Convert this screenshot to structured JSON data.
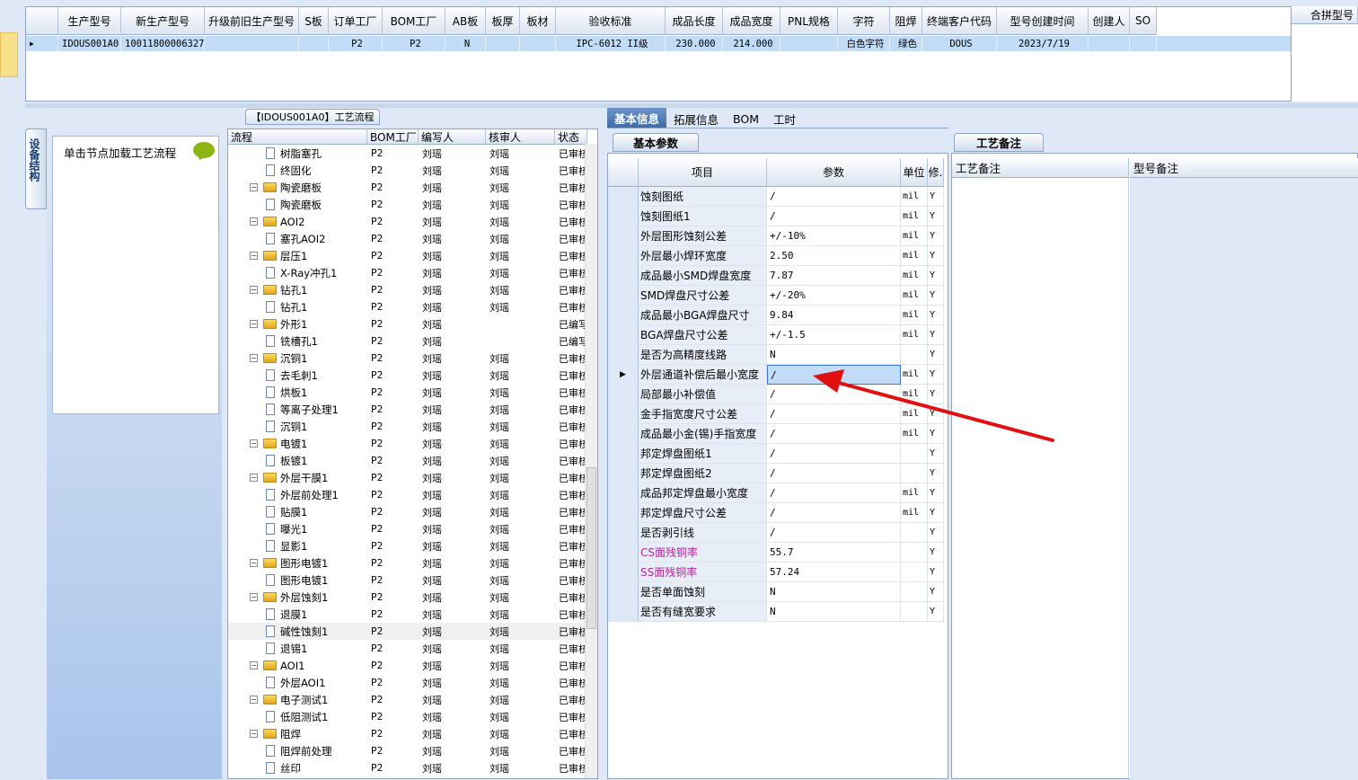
{
  "top_grid": {
    "headers": [
      "生产型号",
      "新生产型号",
      "升级前旧生产型号",
      "S板",
      "订单工厂",
      "BOM工厂",
      "AB板",
      "板厚",
      "板材",
      "验收标准",
      "成品长度",
      "成品宽度",
      "PNL规格",
      "字符",
      "阻焊",
      "终端客户代码",
      "型号创建时间",
      "创建人",
      "SO"
    ],
    "row": [
      "IDOUS001A0",
      "10011800006327",
      "",
      "",
      "P2",
      "P2",
      "N",
      "",
      "",
      "IPC-6012 II级",
      "230.000",
      "214.000",
      "",
      "白色字符",
      "绿色",
      "DOUS",
      "2023/7/19",
      "",
      ""
    ]
  },
  "right_panel": {
    "header": "合拼型号"
  },
  "tree_tab": "【IDOUS001A0】工艺流程",
  "side_tab": "设备结构",
  "load_text": "单击节点加载工艺流程",
  "tree": {
    "headers": [
      "流程",
      "BOM工厂",
      "编写人",
      "核审人",
      "状态"
    ],
    "rows": [
      {
        "level": 2,
        "type": "file",
        "name": "树脂塞孔",
        "bom": "P2",
        "writer": "刘瑶",
        "checker": "刘瑶",
        "status": "已审核"
      },
      {
        "level": 2,
        "type": "file",
        "name": "终固化",
        "bom": "P2",
        "writer": "刘瑶",
        "checker": "刘瑶",
        "status": "已审核"
      },
      {
        "level": 1,
        "type": "folder",
        "name": "陶瓷磨板",
        "bom": "P2",
        "writer": "刘瑶",
        "checker": "刘瑶",
        "status": "已审核"
      },
      {
        "level": 2,
        "type": "file",
        "name": "陶瓷磨板",
        "bom": "P2",
        "writer": "刘瑶",
        "checker": "刘瑶",
        "status": "已审核"
      },
      {
        "level": 1,
        "type": "folder",
        "name": "AOI2",
        "bom": "P2",
        "writer": "刘瑶",
        "checker": "刘瑶",
        "status": "已审核"
      },
      {
        "level": 2,
        "type": "file",
        "name": "塞孔AOI2",
        "bom": "P2",
        "writer": "刘瑶",
        "checker": "刘瑶",
        "status": "已审核"
      },
      {
        "level": 1,
        "type": "folder",
        "name": "层压1",
        "bom": "P2",
        "writer": "刘瑶",
        "checker": "刘瑶",
        "status": "已审核"
      },
      {
        "level": 2,
        "type": "file",
        "name": "X-Ray冲孔1",
        "bom": "P2",
        "writer": "刘瑶",
        "checker": "刘瑶",
        "status": "已审核"
      },
      {
        "level": 1,
        "type": "folder",
        "name": "钻孔1",
        "bom": "P2",
        "writer": "刘瑶",
        "checker": "刘瑶",
        "status": "已审核"
      },
      {
        "level": 2,
        "type": "file",
        "name": "钻孔1",
        "bom": "P2",
        "writer": "刘瑶",
        "checker": "刘瑶",
        "status": "已审核"
      },
      {
        "level": 1,
        "type": "folder",
        "name": "外形1",
        "bom": "P2",
        "writer": "刘瑶",
        "checker": "",
        "status": "已编写"
      },
      {
        "level": 2,
        "type": "file",
        "name": "铣槽孔1",
        "bom": "P2",
        "writer": "刘瑶",
        "checker": "",
        "status": "已编写"
      },
      {
        "level": 1,
        "type": "folder",
        "name": "沉铜1",
        "bom": "P2",
        "writer": "刘瑶",
        "checker": "刘瑶",
        "status": "已审核"
      },
      {
        "level": 2,
        "type": "file",
        "name": "去毛刺1",
        "bom": "P2",
        "writer": "刘瑶",
        "checker": "刘瑶",
        "status": "已审核"
      },
      {
        "level": 2,
        "type": "file",
        "name": "烘板1",
        "bom": "P2",
        "writer": "刘瑶",
        "checker": "刘瑶",
        "status": "已审核"
      },
      {
        "level": 2,
        "type": "file",
        "name": "等离子处理1",
        "bom": "P2",
        "writer": "刘瑶",
        "checker": "刘瑶",
        "status": "已审核"
      },
      {
        "level": 2,
        "type": "file",
        "name": "沉铜1",
        "bom": "P2",
        "writer": "刘瑶",
        "checker": "刘瑶",
        "status": "已审核"
      },
      {
        "level": 1,
        "type": "folder",
        "name": "电镀1",
        "bom": "P2",
        "writer": "刘瑶",
        "checker": "刘瑶",
        "status": "已审核"
      },
      {
        "level": 2,
        "type": "file",
        "name": "板镀1",
        "bom": "P2",
        "writer": "刘瑶",
        "checker": "刘瑶",
        "status": "已审核"
      },
      {
        "level": 1,
        "type": "folder",
        "name": "外层干膜1",
        "bom": "P2",
        "writer": "刘瑶",
        "checker": "刘瑶",
        "status": "已审核"
      },
      {
        "level": 2,
        "type": "file",
        "name": "外层前处理1",
        "bom": "P2",
        "writer": "刘瑶",
        "checker": "刘瑶",
        "status": "已审核"
      },
      {
        "level": 2,
        "type": "file",
        "name": "贴膜1",
        "bom": "P2",
        "writer": "刘瑶",
        "checker": "刘瑶",
        "status": "已审核"
      },
      {
        "level": 2,
        "type": "file",
        "name": "曝光1",
        "bom": "P2",
        "writer": "刘瑶",
        "checker": "刘瑶",
        "status": "已审核"
      },
      {
        "level": 2,
        "type": "file",
        "name": "显影1",
        "bom": "P2",
        "writer": "刘瑶",
        "checker": "刘瑶",
        "status": "已审核"
      },
      {
        "level": 1,
        "type": "folder",
        "name": "图形电镀1",
        "bom": "P2",
        "writer": "刘瑶",
        "checker": "刘瑶",
        "status": "已审核"
      },
      {
        "level": 2,
        "type": "file",
        "name": "图形电镀1",
        "bom": "P2",
        "writer": "刘瑶",
        "checker": "刘瑶",
        "status": "已审核"
      },
      {
        "level": 1,
        "type": "folder",
        "name": "外层蚀刻1",
        "bom": "P2",
        "writer": "刘瑶",
        "checker": "刘瑶",
        "status": "已审核"
      },
      {
        "level": 2,
        "type": "file",
        "name": "退膜1",
        "bom": "P2",
        "writer": "刘瑶",
        "checker": "刘瑶",
        "status": "已审核"
      },
      {
        "level": 2,
        "type": "file",
        "name": "碱性蚀刻1",
        "bom": "P2",
        "writer": "刘瑶",
        "checker": "刘瑶",
        "status": "已审核",
        "selected": true
      },
      {
        "level": 2,
        "type": "file",
        "name": "退锡1",
        "bom": "P2",
        "writer": "刘瑶",
        "checker": "刘瑶",
        "status": "已审核"
      },
      {
        "level": 1,
        "type": "folder",
        "name": "AOI1",
        "bom": "P2",
        "writer": "刘瑶",
        "checker": "刘瑶",
        "status": "已审核"
      },
      {
        "level": 2,
        "type": "file",
        "name": "外层AOI1",
        "bom": "P2",
        "writer": "刘瑶",
        "checker": "刘瑶",
        "status": "已审核"
      },
      {
        "level": 1,
        "type": "folder",
        "name": "电子测试1",
        "bom": "P2",
        "writer": "刘瑶",
        "checker": "刘瑶",
        "status": "已审核"
      },
      {
        "level": 2,
        "type": "file",
        "name": "低阻测试1",
        "bom": "P2",
        "writer": "刘瑶",
        "checker": "刘瑶",
        "status": "已审核"
      },
      {
        "level": 1,
        "type": "folder",
        "name": "阻焊",
        "bom": "P2",
        "writer": "刘瑶",
        "checker": "刘瑶",
        "status": "已审核"
      },
      {
        "level": 2,
        "type": "file",
        "name": "阻焊前处理",
        "bom": "P2",
        "writer": "刘瑶",
        "checker": "刘瑶",
        "status": "已审核"
      },
      {
        "level": 2,
        "type": "file",
        "name": "丝印",
        "bom": "P2",
        "writer": "刘瑶",
        "checker": "刘瑶",
        "status": "已审核"
      }
    ]
  },
  "mid_tabs": [
    "基本信息",
    "拓展信息",
    "BOM",
    "工时"
  ],
  "sub_tab": "基本参数",
  "basic": {
    "headers": [
      "项目",
      "参数",
      "单位",
      "修."
    ],
    "rows": [
      {
        "item": "蚀刻图纸",
        "value": "/",
        "unit": "mil",
        "mod": "Y"
      },
      {
        "item": "蚀刻图纸1",
        "value": "/",
        "unit": "mil",
        "mod": "Y"
      },
      {
        "item": "外层图形蚀刻公差",
        "value": "+/-10%",
        "unit": "mil",
        "mod": "Y"
      },
      {
        "item": "外层最小焊环宽度",
        "value": "2.50",
        "unit": "mil",
        "mod": "Y"
      },
      {
        "item": "成品最小SMD焊盘宽度",
        "value": "7.87",
        "unit": "mil",
        "mod": "Y"
      },
      {
        "item": "SMD焊盘尺寸公差",
        "value": "+/-20%",
        "unit": "mil",
        "mod": "Y"
      },
      {
        "item": "成品最小BGA焊盘尺寸",
        "value": "9.84",
        "unit": "mil",
        "mod": "Y"
      },
      {
        "item": "BGA焊盘尺寸公差",
        "value": "+/-1.5",
        "unit": "mil",
        "mod": "Y"
      },
      {
        "item": "是否为高精度线路",
        "value": "N",
        "unit": "",
        "mod": "Y"
      },
      {
        "item": "外层通道补偿后最小宽度",
        "value": "/",
        "unit": "mil",
        "mod": "Y",
        "current": true
      },
      {
        "item": "局部最小补偿值",
        "value": "/",
        "unit": "mil",
        "mod": "Y"
      },
      {
        "item": "金手指宽度尺寸公差",
        "value": "/",
        "unit": "mil",
        "mod": "Y"
      },
      {
        "item": "成品最小金(锡)手指宽度",
        "value": "/",
        "unit": "mil",
        "mod": "Y"
      },
      {
        "item": "邦定焊盘图纸1",
        "value": "/",
        "unit": "",
        "mod": "Y"
      },
      {
        "item": "邦定焊盘图纸2",
        "value": "/",
        "unit": "",
        "mod": "Y"
      },
      {
        "item": "成品邦定焊盘最小宽度",
        "value": "/",
        "unit": "mil",
        "mod": "Y"
      },
      {
        "item": "邦定焊盘尺寸公差",
        "value": "/",
        "unit": "mil",
        "mod": "Y"
      },
      {
        "item": "是否剥引线",
        "value": "/",
        "unit": "",
        "mod": "Y"
      },
      {
        "item": "CS面残铜率",
        "value": "55.7",
        "unit": "",
        "mod": "Y",
        "color": "#b0289a"
      },
      {
        "item": "SS面残铜率",
        "value": "57.24",
        "unit": "",
        "mod": "Y",
        "color": "#b0289a"
      },
      {
        "item": "是否单面蚀刻",
        "value": "N",
        "unit": "",
        "mod": "Y"
      },
      {
        "item": "是否有缝宽要求",
        "value": "N",
        "unit": "",
        "mod": "Y"
      }
    ]
  },
  "notes": {
    "tab": "工艺备注",
    "col1": "工艺备注",
    "col2": "型号备注"
  },
  "colors": {
    "selected_row": "#c2dcf7",
    "arrow": "#e01010",
    "accent": "#3f6ba8"
  }
}
